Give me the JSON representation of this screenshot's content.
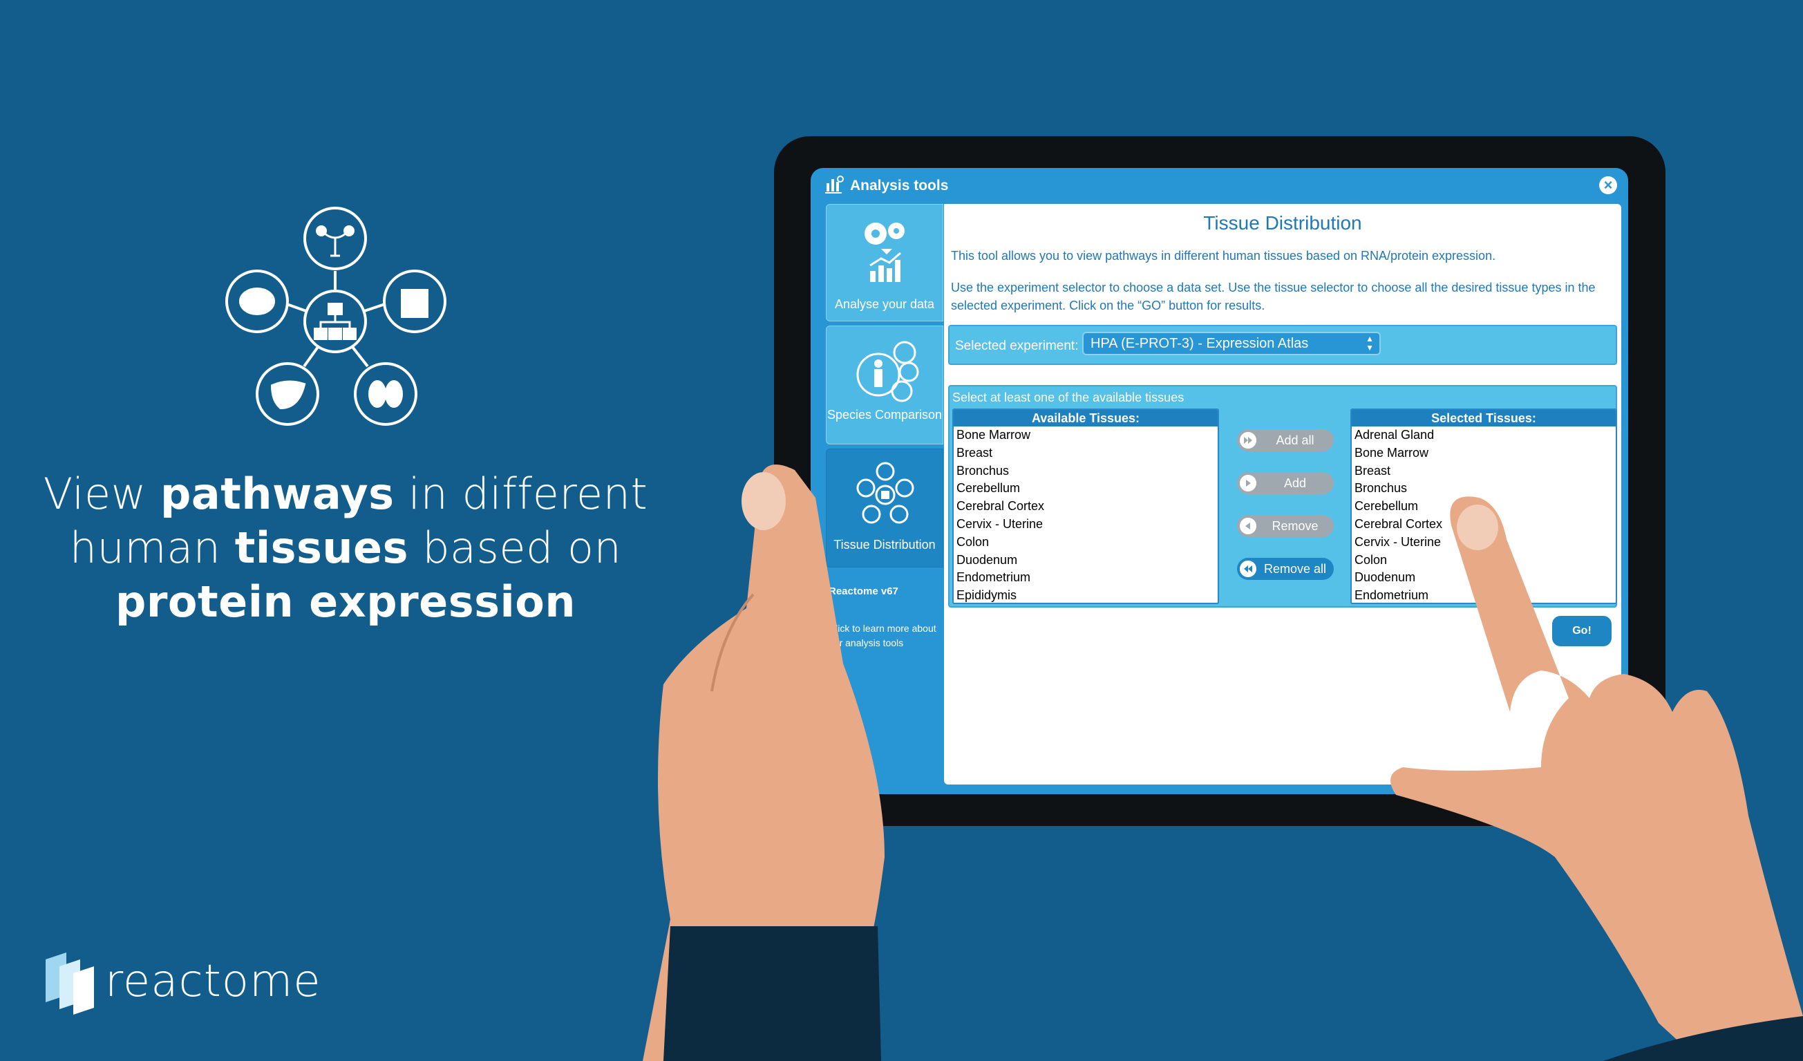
{
  "hero": {
    "line1_a": "View ",
    "line1_b": "pathways",
    "line1_c": " in different",
    "line2_a": "human ",
    "line2_b": "tissues",
    "line2_c": " based on",
    "line3": "protein expression"
  },
  "logo": {
    "text": "reactome"
  },
  "window": {
    "title": "Analysis tools",
    "close_label": "×"
  },
  "sidebar": {
    "items": [
      {
        "label": "Analyse your data",
        "icon": "gears-chart-icon"
      },
      {
        "label": "Species Comparison",
        "icon": "species-icon"
      },
      {
        "label": "Tissue Distribution",
        "icon": "tissue-icon",
        "active": true
      }
    ],
    "version": "Reactome v67",
    "learn_more": "Click to learn more about our analysis tools"
  },
  "main": {
    "title": "Tissue Distribution",
    "description1": "This tool allows you to view pathways in different human tissues based on RNA/protein expression.",
    "description2": "Use the experiment selector to choose a data set. Use the tissue selector to choose all the desired tissue types in the selected experiment. Click on the “GO” button for results.",
    "experiment_label": "Selected experiment:",
    "experiment_value": "HPA (E-PROT-3) - Expression Atlas",
    "tissue_hint": "Select at least one of the available tissues",
    "available_header": "Available Tissues:",
    "selected_header": "Selected Tissues:",
    "available": [
      "Bone Marrow",
      "Breast",
      "Bronchus",
      "Cerebellum",
      "Cerebral Cortex",
      "Cervix - Uterine",
      "Colon",
      "Duodenum",
      "Endometrium",
      "Epididymis"
    ],
    "selected": [
      "Adrenal Gland",
      "Bone Marrow",
      "Breast",
      "Bronchus",
      "Cerebellum",
      "Cerebral Cortex",
      "Cervix - Uterine",
      "Colon",
      "Duodenum",
      "Endometrium"
    ],
    "buttons": {
      "add_all": "Add all",
      "add": "Add",
      "remove": "Remove",
      "remove_all": "Remove all",
      "go": "Go!"
    }
  },
  "colors": {
    "background": "#135d8c",
    "accent": "#2896d4",
    "title": "#1f78b8",
    "skin": "#e8a987",
    "sleeve": "#0c2a40"
  }
}
